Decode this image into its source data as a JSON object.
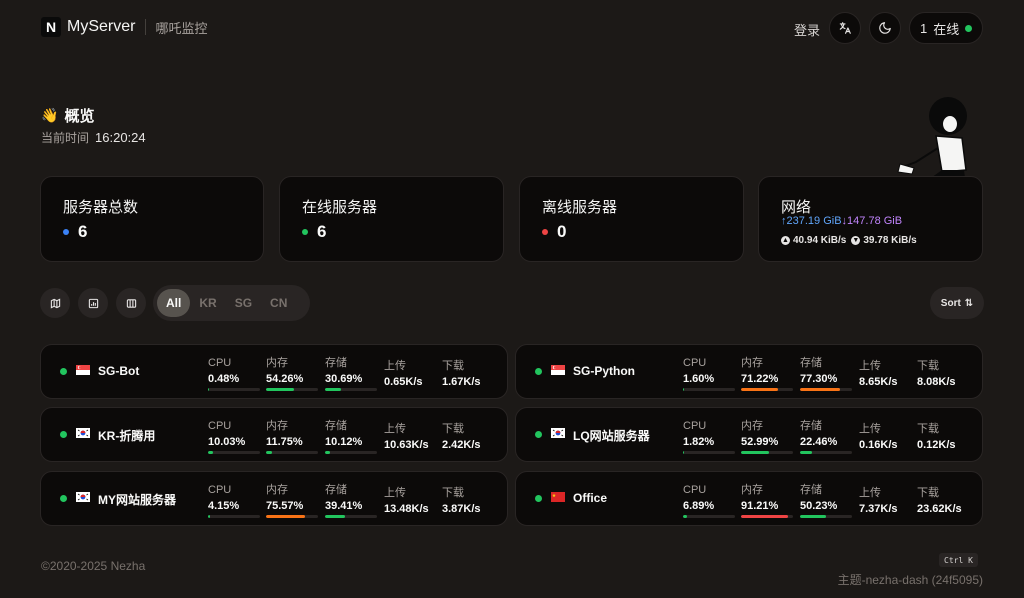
{
  "header": {
    "logo_letter": "N",
    "brand_name": "MyServer",
    "brand_sub": "哪吒监控",
    "login_label": "登录",
    "online_count": "1",
    "online_label": "在线"
  },
  "overview": {
    "title": "概览",
    "time_label": "当前时间",
    "time_value": "16:20:24"
  },
  "stats": {
    "total": {
      "title": "服务器总数",
      "value": "6",
      "dot_color": "#3b82f6"
    },
    "online": {
      "title": "在线服务器",
      "value": "6",
      "dot_color": "#22c55e"
    },
    "offline": {
      "title": "离线服务器",
      "value": "0",
      "dot_color": "#ef4444"
    },
    "network": {
      "title": "网络",
      "up_total": "↑237.19 GiB",
      "down_total": "↓147.78 GiB",
      "up_speed": "40.94 KiB/s",
      "down_speed": "39.78 KiB/s"
    }
  },
  "filters": {
    "tabs": [
      {
        "label": "All",
        "active": true
      },
      {
        "label": "KR",
        "active": false
      },
      {
        "label": "SG",
        "active": false
      },
      {
        "label": "CN",
        "active": false
      }
    ],
    "sort_label": "Sort"
  },
  "labels": {
    "cpu": "CPU",
    "mem": "内存",
    "disk": "存储",
    "up": "上传",
    "down": "下载"
  },
  "servers": [
    {
      "name": "SG-Bot",
      "flag": "sg",
      "cpu": "0.48%",
      "cpu_pct": 0.48,
      "mem": "54.26%",
      "mem_pct": 54.26,
      "disk": "30.69%",
      "disk_pct": 30.69,
      "up": "0.65K/s",
      "down": "1.67K/s"
    },
    {
      "name": "SG-Python",
      "flag": "sg",
      "cpu": "1.60%",
      "cpu_pct": 1.6,
      "mem": "71.22%",
      "mem_pct": 71.22,
      "disk": "77.30%",
      "disk_pct": 77.3,
      "up": "8.65K/s",
      "down": "8.08K/s"
    },
    {
      "name": "KR-折腾用",
      "flag": "kr",
      "cpu": "10.03%",
      "cpu_pct": 10.03,
      "mem": "11.75%",
      "mem_pct": 11.75,
      "disk": "10.12%",
      "disk_pct": 10.12,
      "up": "10.63K/s",
      "down": "2.42K/s"
    },
    {
      "name": "LQ网站服务器",
      "flag": "kr",
      "cpu": "1.82%",
      "cpu_pct": 1.82,
      "mem": "52.99%",
      "mem_pct": 52.99,
      "disk": "22.46%",
      "disk_pct": 22.46,
      "up": "0.16K/s",
      "down": "0.12K/s"
    },
    {
      "name": "MY网站服务器",
      "flag": "kr",
      "cpu": "4.15%",
      "cpu_pct": 4.15,
      "mem": "75.57%",
      "mem_pct": 75.57,
      "disk": "39.41%",
      "disk_pct": 39.41,
      "up": "13.48K/s",
      "down": "3.87K/s"
    },
    {
      "name": "Office",
      "flag": "cn",
      "cpu": "6.89%",
      "cpu_pct": 6.89,
      "mem": "91.21%",
      "mem_pct": 91.21,
      "disk": "50.23%",
      "disk_pct": 50.23,
      "up": "7.37K/s",
      "down": "23.62K/s"
    }
  ],
  "footer": {
    "copyright": "©2020-2025 Nezha",
    "kbd": "Ctrl K",
    "theme": "主题-nezha-dash (24f5095)"
  },
  "colors": {
    "ok": "#22c55e",
    "warn": "#f97316",
    "danger": "#ef4444"
  }
}
